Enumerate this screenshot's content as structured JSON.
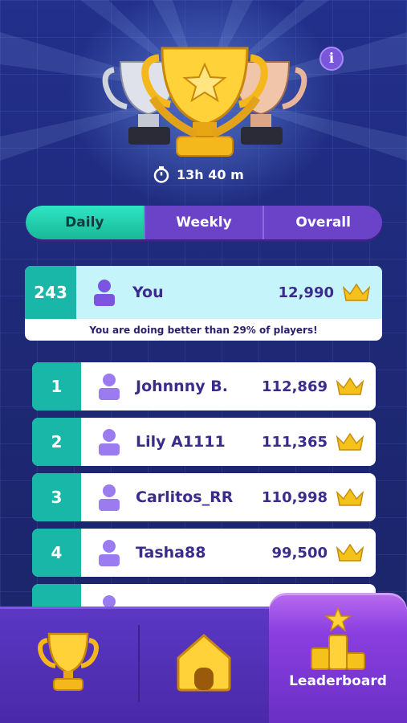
{
  "header": {
    "timer": "13h 40 m",
    "info_label": "i"
  },
  "tabs": [
    {
      "label": "Daily",
      "active": true
    },
    {
      "label": "Weekly",
      "active": false
    },
    {
      "label": "Overall",
      "active": false
    }
  ],
  "you": {
    "rank": "243",
    "name": "You",
    "score": "12,990",
    "message": "You are doing better than 29% of players!"
  },
  "leaderboard": [
    {
      "rank": "1",
      "name": "Johnnny B.",
      "score": "112,869"
    },
    {
      "rank": "2",
      "name": "Lily A1111",
      "score": "111,365"
    },
    {
      "rank": "3",
      "name": "Carlitos_RR",
      "score": "110,998"
    },
    {
      "rank": "4",
      "name": "Tasha88",
      "score": "99,500"
    }
  ],
  "nav": {
    "active_label": "Leaderboard",
    "icons": [
      "trophy-icon",
      "home-icon",
      "podium-icon"
    ]
  },
  "colors": {
    "background": "#1f2a7a",
    "accent_teal": "#18b7a8",
    "tab_purple": "#6b43c9",
    "text_purple": "#3b2b8c",
    "gold": "#f5c21c"
  }
}
